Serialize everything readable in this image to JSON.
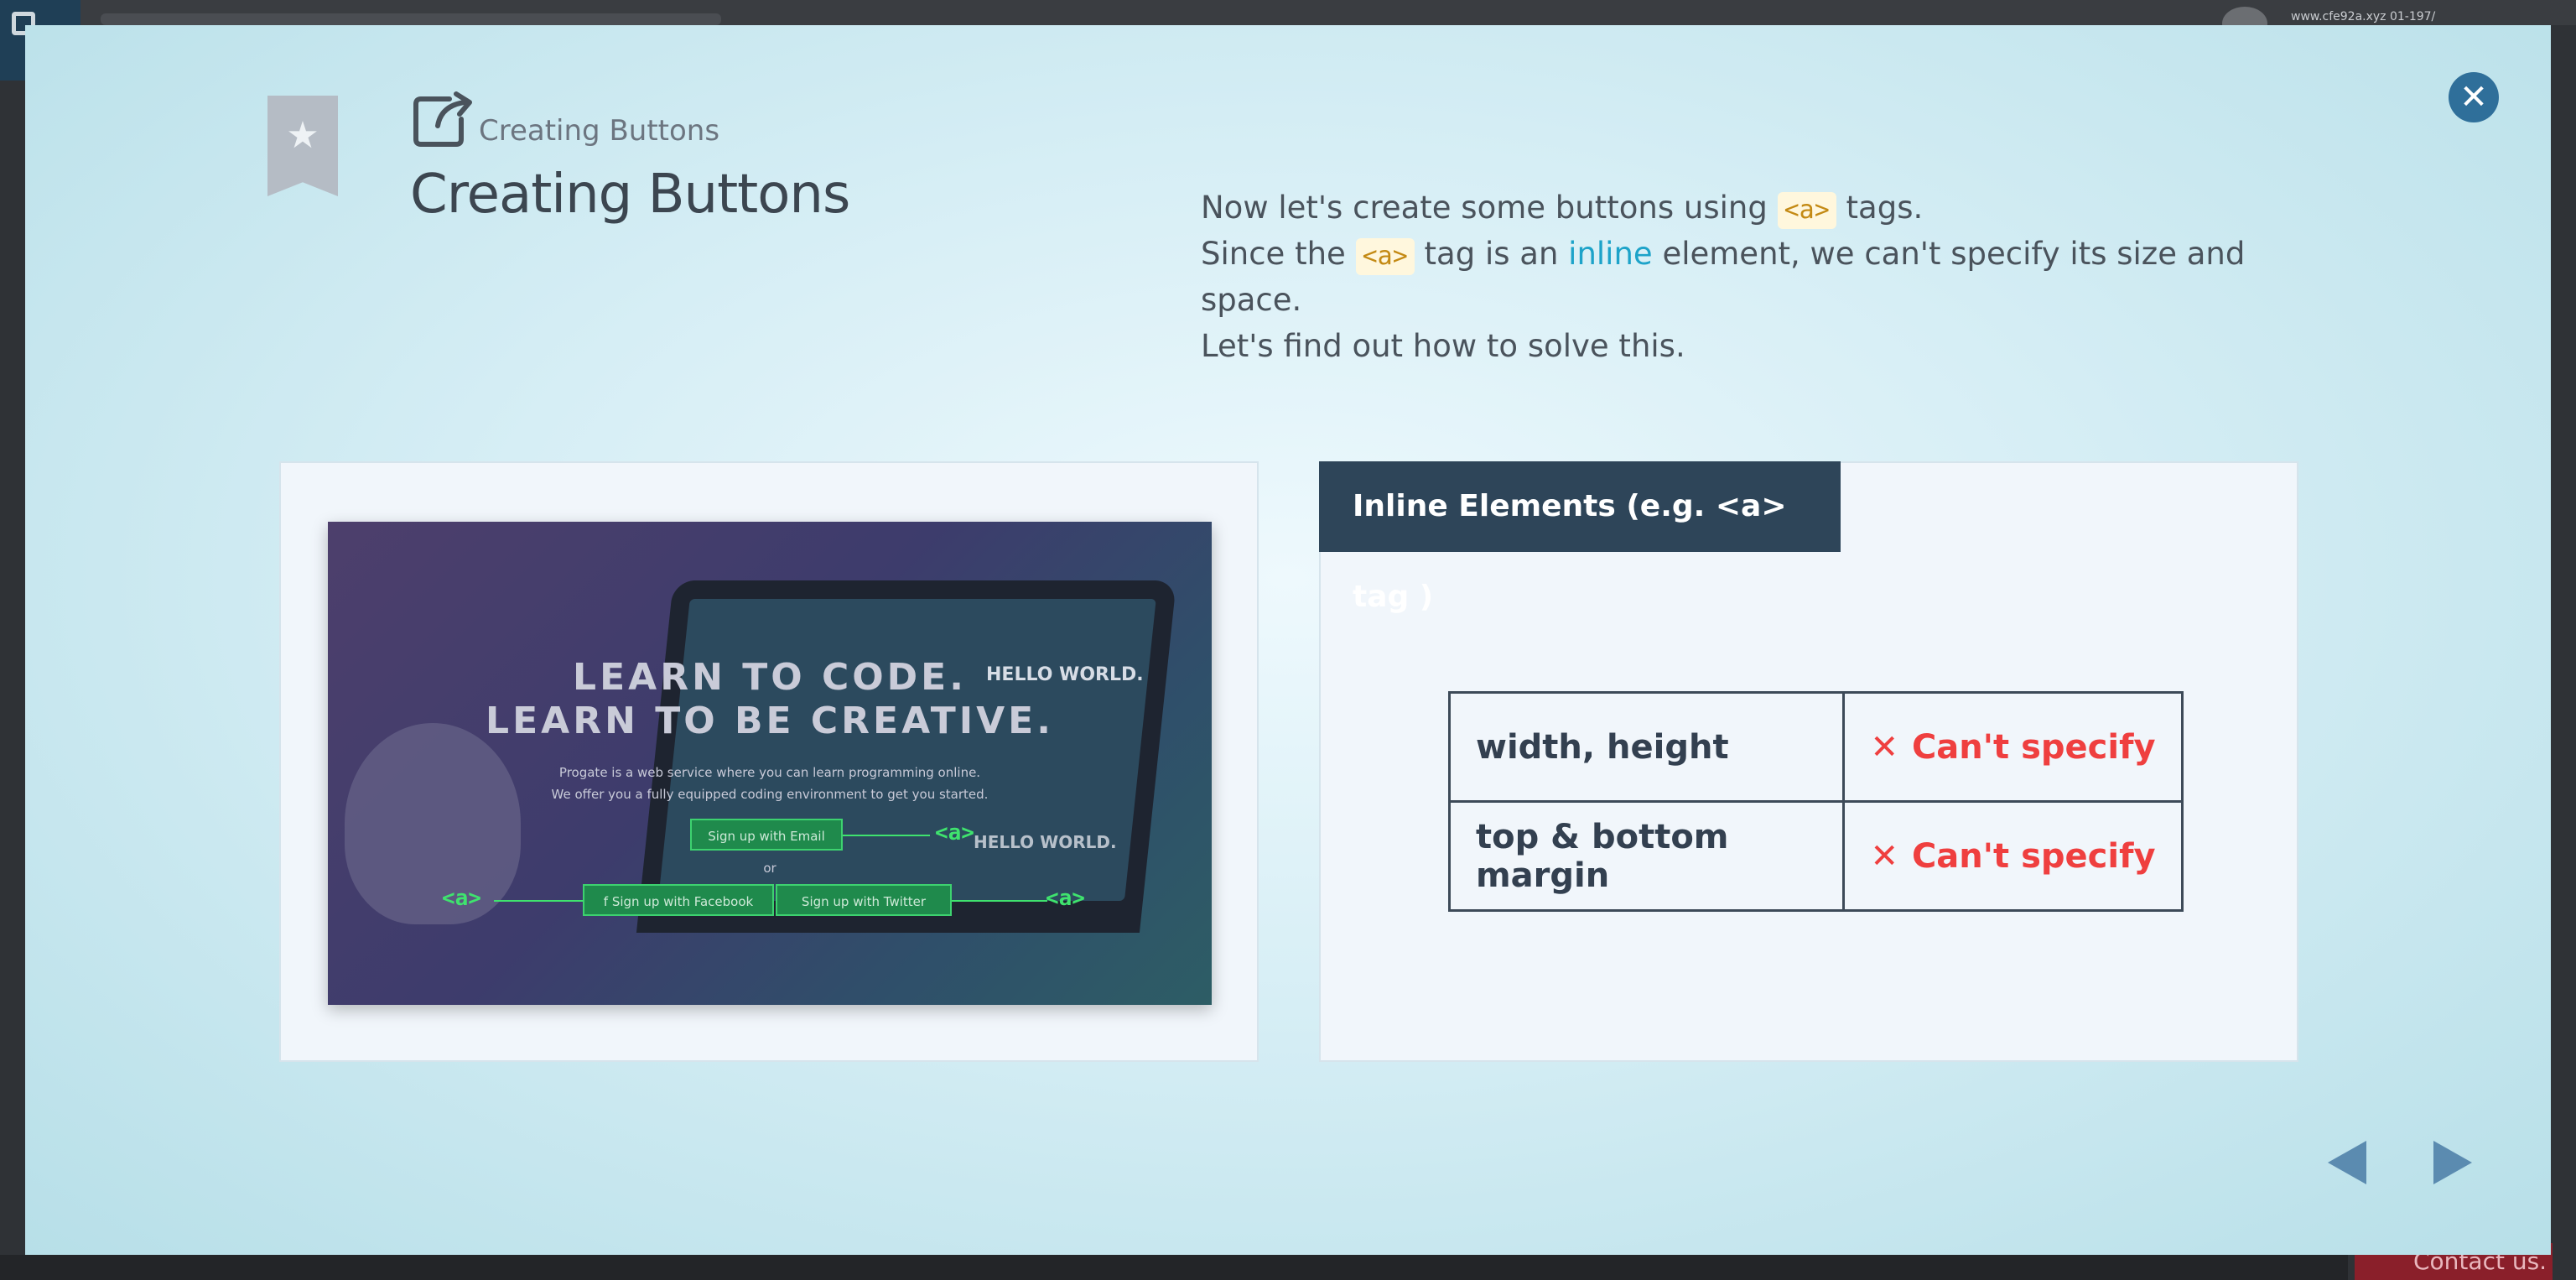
{
  "background_page": {
    "url_text": "www.cfe92a.xyz 01-197/",
    "contact_label": "Contact us."
  },
  "lesson": {
    "breadcrumb": "Creating Buttons",
    "title": "Creating Buttons",
    "description": {
      "line1_before": "Now let's create some buttons using",
      "line1_code": "<a>",
      "line1_after": "tags.",
      "line2_before": "Since the",
      "line2_code": "<a>",
      "line2_middle": "tag is an",
      "line2_link": "inline",
      "line2_after": "element, we can't specify its size and space.",
      "line3": "Let's find out how to solve this."
    }
  },
  "screenshot_image": {
    "headline1": "LEARN TO CODE.",
    "headline2": "LEARN TO BE CREATIVE.",
    "para1": "Progate is a web service where you can learn programming online.",
    "para2": "We offer you a fully equipped coding environment to get you started.",
    "btn_email": "Sign up with Email",
    "or_text": "or",
    "btn_facebook": "f  Sign up with Facebook",
    "btn_twitter": "Sign up with Twitter",
    "tag_label": "<a>",
    "screen_text1": "HELLO WORLD.",
    "screen_text2": "HELLO WORLD."
  },
  "inline_panel": {
    "heading": "Inline Elements (e.g. <a> tag )",
    "rows": [
      {
        "property": "width, height",
        "mark": "✕",
        "value": "Can't specify"
      },
      {
        "property": "top & bottom margin",
        "mark": "✕",
        "value": "Can't specify"
      }
    ]
  },
  "icons": {
    "close": "close-icon",
    "bookmark": "bookmark-star-icon",
    "share": "external-link-icon",
    "prev": "triangle-left-icon",
    "next": "triangle-right-icon"
  },
  "colors": {
    "accent": "#2f6f9a",
    "header_dark": "#2e4559",
    "error_red": "#ef3f3f",
    "link": "#1da3c9",
    "highlight_green": "#3fe36e"
  }
}
